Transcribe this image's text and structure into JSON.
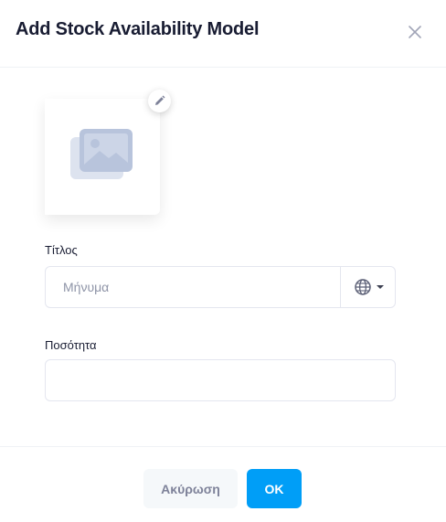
{
  "modal": {
    "title": "Add Stock Availability Model",
    "close_icon": "close-icon"
  },
  "image_upload": {
    "placeholder_icon": "image-placeholder-icon",
    "edit_icon": "pencil-icon"
  },
  "form": {
    "title_label": "Τίτλος",
    "title_placeholder": "Μήνυμα",
    "title_value": "",
    "language_icon": "globe-icon",
    "quantity_label": "Ποσότητα",
    "quantity_value": ""
  },
  "footer": {
    "cancel_label": "Ακύρωση",
    "ok_label": "OK"
  },
  "colors": {
    "primary": "#009ef7",
    "cancel_bg": "#f5f8fa",
    "border": "#e4e6ef"
  }
}
